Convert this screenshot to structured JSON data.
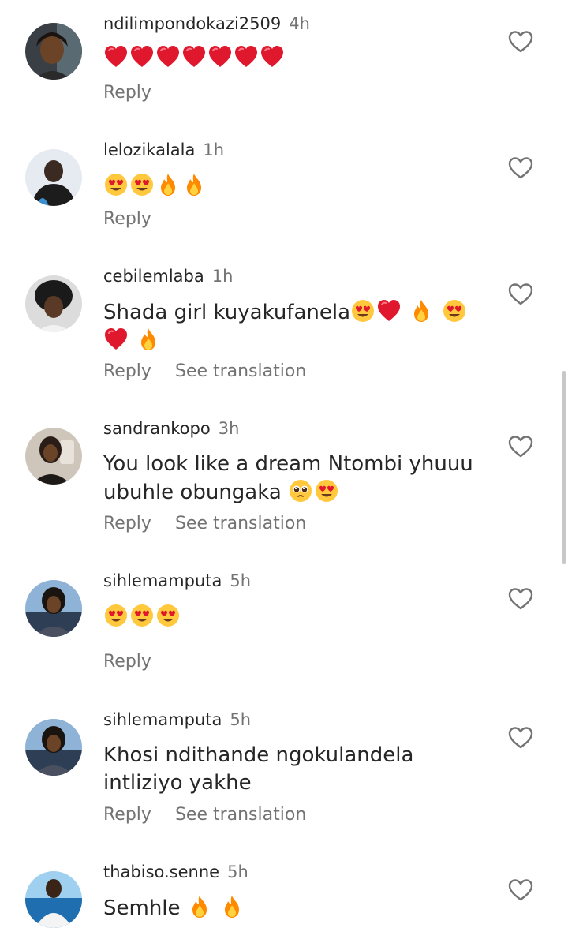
{
  "colors": {
    "text": "#262626",
    "secondary": "#737373",
    "heart": "#e0182d",
    "flame": "#ff8a00",
    "face": "#ffc83d"
  },
  "comments": [
    {
      "username": "ndilimpondokazi2509",
      "time": "4h",
      "emoji": [
        "red-heart",
        "red-heart",
        "red-heart",
        "red-heart",
        "red-heart",
        "red-heart",
        "red-heart"
      ],
      "reply": "Reply"
    },
    {
      "username": "lelozikalala",
      "time": "1h",
      "emoji": [
        "heart-eyes",
        "heart-eyes",
        "fire",
        "fire"
      ],
      "reply": "Reply"
    },
    {
      "username": "cebilemlaba",
      "time": "1h",
      "text": "Shada girl kuyakufanela",
      "emoji": [
        "heart-eyes",
        "red-heart",
        "fire",
        "heart-eyes",
        "red-heart",
        "fire"
      ],
      "reply": "Reply",
      "see_translation": "See translation"
    },
    {
      "username": "sandrankopo",
      "time": "3h",
      "text_line1": "You look like a dream Ntombi yhuuu",
      "text_line2": "ubuhle obungaka",
      "emoji": [
        "pleading-face",
        "heart-eyes"
      ],
      "reply": "Reply",
      "see_translation": "See translation"
    },
    {
      "username": "sihlemamputa",
      "time": "5h",
      "emoji": [
        "heart-eyes",
        "heart-eyes",
        "heart-eyes"
      ],
      "reply": "Reply"
    },
    {
      "username": "sihlemamputa",
      "time": "5h",
      "text_line1": "Khosi ndithande ngokulandela",
      "text_line2": "intliziyo yakhe",
      "reply": "Reply",
      "see_translation": "See translation"
    },
    {
      "username": "thabiso.senne",
      "time": "5h",
      "text": "Semhle",
      "emoji": [
        "fire",
        "fire"
      ]
    }
  ]
}
